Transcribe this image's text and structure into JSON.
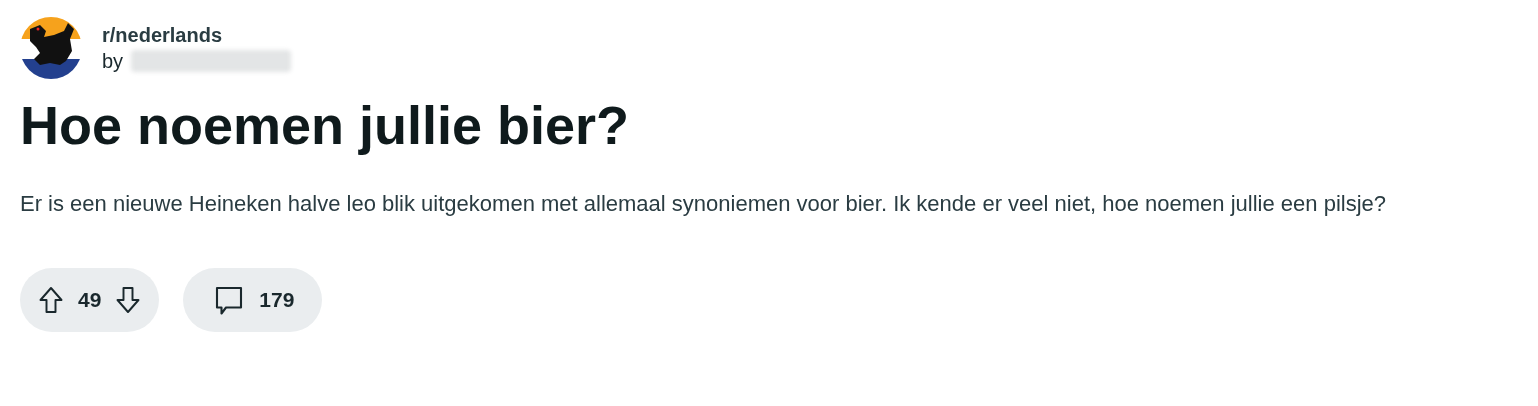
{
  "post": {
    "subreddit": "r/nederlands",
    "byline": "by",
    "title": "Hoe noemen jullie bier?",
    "body": "Er is een nieuwe Heineken halve leo blik uitgekomen met allemaal synoniemen voor bier. Ik kende er veel niet, hoe noemen jullie een pilsje?"
  },
  "actions": {
    "score": "49",
    "comments": "179"
  }
}
